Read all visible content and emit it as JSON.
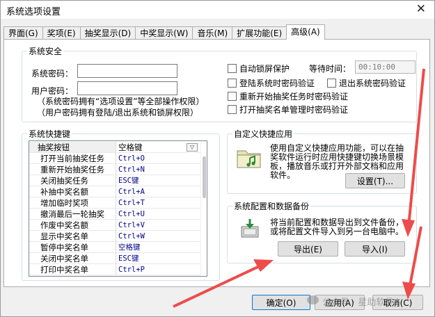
{
  "window": {
    "title": "系统选项设置",
    "close_glyph": "✕"
  },
  "tabs": [
    {
      "label": "界面(G)"
    },
    {
      "label": "奖项(E)"
    },
    {
      "label": "抽奖显示(D)"
    },
    {
      "label": "中奖显示(W)"
    },
    {
      "label": "音乐(M)"
    },
    {
      "label": "扩展功能(E)"
    },
    {
      "label": "高级(A)",
      "active": true
    }
  ],
  "security": {
    "title": "系统安全",
    "system_password_label": "系统密码：",
    "user_password_label": "用户密码：",
    "note1": "（系统密码拥有“选项设置”等全部操作权限）",
    "note2": "（用户密码拥有登陆/退出系统和锁屏权限）",
    "auto_lock": "自动锁屏保护",
    "wait_time_label": "等待时间：",
    "wait_time_value": "00:10:00",
    "login_verify": "登陆系统时密码验证",
    "logout_verify": "退出系统密码验证",
    "restart_verify": "重新开始抽奖任务时密码验证",
    "open_list_verify": "打开抽奖名单管理时密码验证"
  },
  "hotkeys": {
    "title": "系统快捷键",
    "rows": [
      {
        "action": "抽奖按钮",
        "key": "空格键"
      },
      {
        "action": "打开当前抽奖任务",
        "key": "Ctrl+O"
      },
      {
        "action": "重新开始抽奖任务",
        "key": "Ctrl+N"
      },
      {
        "action": "关闭抽奖任务",
        "key": "ESC键"
      },
      {
        "action": "补抽中奖名额",
        "key": "Ctrl+A"
      },
      {
        "action": "增加临时奖项",
        "key": "Ctrl+T"
      },
      {
        "action": "撤消最后一轮抽奖",
        "key": "Ctrl+U"
      },
      {
        "action": "作废中奖名额",
        "key": "Ctrl+V"
      },
      {
        "action": "显示中奖名单",
        "key": "Ctrl+W"
      },
      {
        "action": "暂停中奖名单",
        "key": "空格键"
      },
      {
        "action": "关闭中奖名单",
        "key": "ESC键"
      },
      {
        "action": "打印中奖名单",
        "key": "Ctrl+P"
      }
    ],
    "dropdown_glyph": "▽"
  },
  "custom_app": {
    "title": "自定义快捷应用",
    "desc": [
      "使用自定义快捷应用功能，可以在抽",
      "奖软件运行时应用快捷键切换场景模",
      "板，播放音乐或打开外部文档和应用",
      "软件。"
    ],
    "settings_button": "设置(T)..."
  },
  "backup": {
    "title": "系统配置和数据备份",
    "desc": [
      "将当前配置和数据导出到文件备份，",
      "或将配置文件导入到另一台电脑中。"
    ],
    "export_button": "导出(E)",
    "import_button": "导入(I)"
  },
  "footer": {
    "ok": "确定(O)",
    "apply": "应用(A)",
    "cancel": "取消(C)"
  },
  "watermark": "公众号 · 星助软件",
  "colors": {
    "arrow": "#ee4b4b",
    "focus_border": "#0078d7",
    "hotkey_value": "#00008b"
  }
}
